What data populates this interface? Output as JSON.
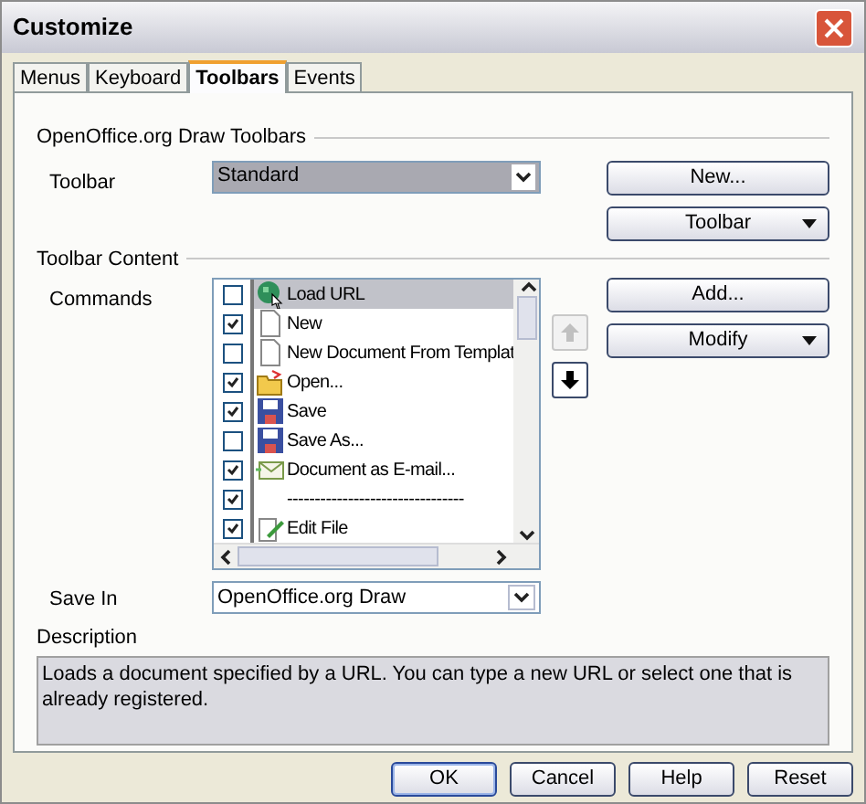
{
  "window": {
    "title": "Customize"
  },
  "tabs": [
    {
      "label": "Menus",
      "selected": false
    },
    {
      "label": "Keyboard",
      "selected": false
    },
    {
      "label": "Toolbars",
      "selected": true
    },
    {
      "label": "Events",
      "selected": false
    }
  ],
  "toolbars_section": {
    "heading": "OpenOffice.org Draw Toolbars",
    "toolbar_label": "Toolbar",
    "toolbar_value": "Standard",
    "new_button": "New...",
    "toolbar_button": "Toolbar"
  },
  "content_section": {
    "heading": "Toolbar Content",
    "commands_label": "Commands",
    "add_button": "Add...",
    "modify_button": "Modify",
    "move_up_disabled": true,
    "move_down_disabled": false
  },
  "commands": [
    {
      "label": "Load URL",
      "kind": "globe",
      "checked": false,
      "selected": true
    },
    {
      "label": "New",
      "kind": "page",
      "checked": true,
      "selected": false
    },
    {
      "label": "New Document From Templat",
      "kind": "page",
      "checked": false,
      "selected": false
    },
    {
      "label": "Open...",
      "kind": "folder",
      "checked": true,
      "selected": false
    },
    {
      "label": "Save",
      "kind": "disk",
      "checked": true,
      "selected": false
    },
    {
      "label": "Save As...",
      "kind": "disk",
      "checked": false,
      "selected": false
    },
    {
      "label": "Document as E-mail...",
      "kind": "mail",
      "checked": true,
      "selected": false
    },
    {
      "label": "--------------------------------",
      "kind": "separator",
      "checked": true,
      "selected": false
    },
    {
      "label": "Edit File",
      "kind": "edit",
      "checked": true,
      "selected": false
    }
  ],
  "save_in": {
    "label": "Save In",
    "value": "OpenOffice.org Draw"
  },
  "description": {
    "label": "Description",
    "text": "Loads a document specified by a URL. You can type a new URL or select one that is already registered."
  },
  "buttons": [
    {
      "label": "OK",
      "kind": "default"
    },
    {
      "label": "Cancel",
      "kind": "normal"
    },
    {
      "label": "Help",
      "kind": "normal"
    },
    {
      "label": "Reset",
      "kind": "normal"
    }
  ]
}
